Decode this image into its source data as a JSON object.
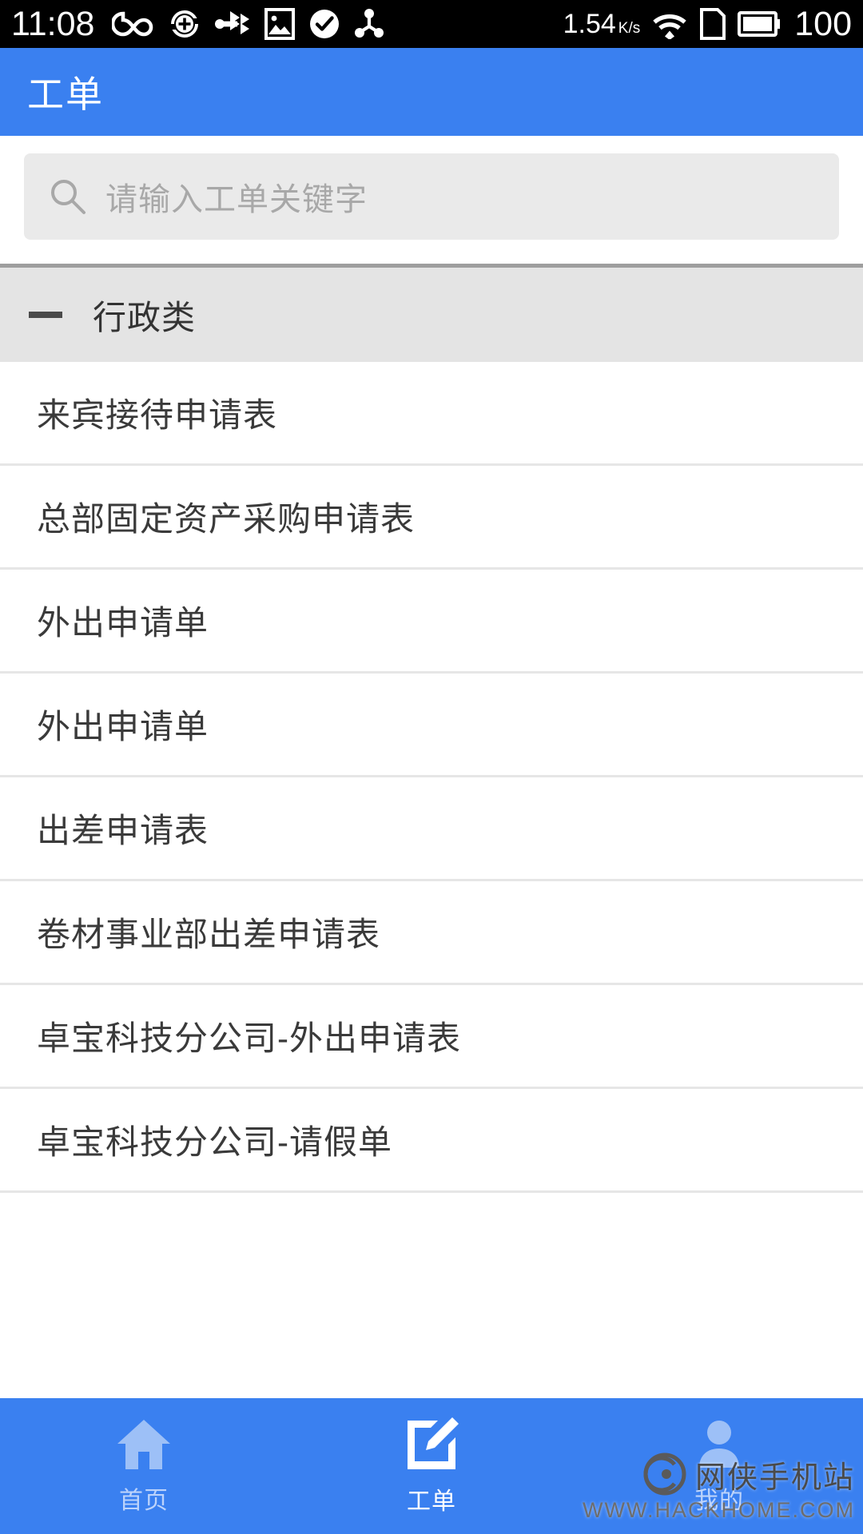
{
  "status_bar": {
    "time": "11:08",
    "network_speed": "1.54",
    "network_speed_unit": "K/s",
    "battery_level": "100",
    "icons": [
      "infinity-icon",
      "sync-add-icon",
      "usb-transfer-icon",
      "image-icon",
      "check-circle-icon",
      "share-nodes-icon",
      "wifi-download-icon",
      "sim-card-icon",
      "battery-icon"
    ]
  },
  "header": {
    "title": "工单"
  },
  "search": {
    "placeholder": "请输入工单关键字",
    "value": "",
    "icon": "search-icon"
  },
  "category": {
    "label": "行政类",
    "toggle_icon": "minus-icon",
    "expanded": true
  },
  "list": {
    "items": [
      {
        "label": "来宾接待申请表"
      },
      {
        "label": "总部固定资产采购申请表"
      },
      {
        "label": "外出申请单"
      },
      {
        "label": "外出申请单"
      },
      {
        "label": "出差申请表"
      },
      {
        "label": "卷材事业部出差申请表"
      },
      {
        "label": "卓宝科技分公司-外出申请表"
      },
      {
        "label": "卓宝科技分公司-请假单"
      }
    ]
  },
  "bottom_nav": {
    "items": [
      {
        "label": "首页",
        "icon": "home-icon",
        "active": false
      },
      {
        "label": "工单",
        "icon": "edit-document-icon",
        "active": true
      },
      {
        "label": "我的",
        "icon": "user-icon",
        "active": false
      }
    ]
  },
  "watermark": {
    "site_name": "网侠手机站",
    "site_url": "WWW.HACKHOME.COM",
    "logo_icon": "watermark-logo-icon"
  },
  "colors": {
    "brand_blue": "#3a80f0",
    "status_bar_bg": "#000000",
    "search_bg": "#eaeaea",
    "category_bg": "#e4e4e4",
    "divider": "#e6e6e6",
    "text_primary": "#3a3a3a",
    "text_placeholder": "#a8a8a8",
    "nav_inactive": "#bcd3fb"
  }
}
